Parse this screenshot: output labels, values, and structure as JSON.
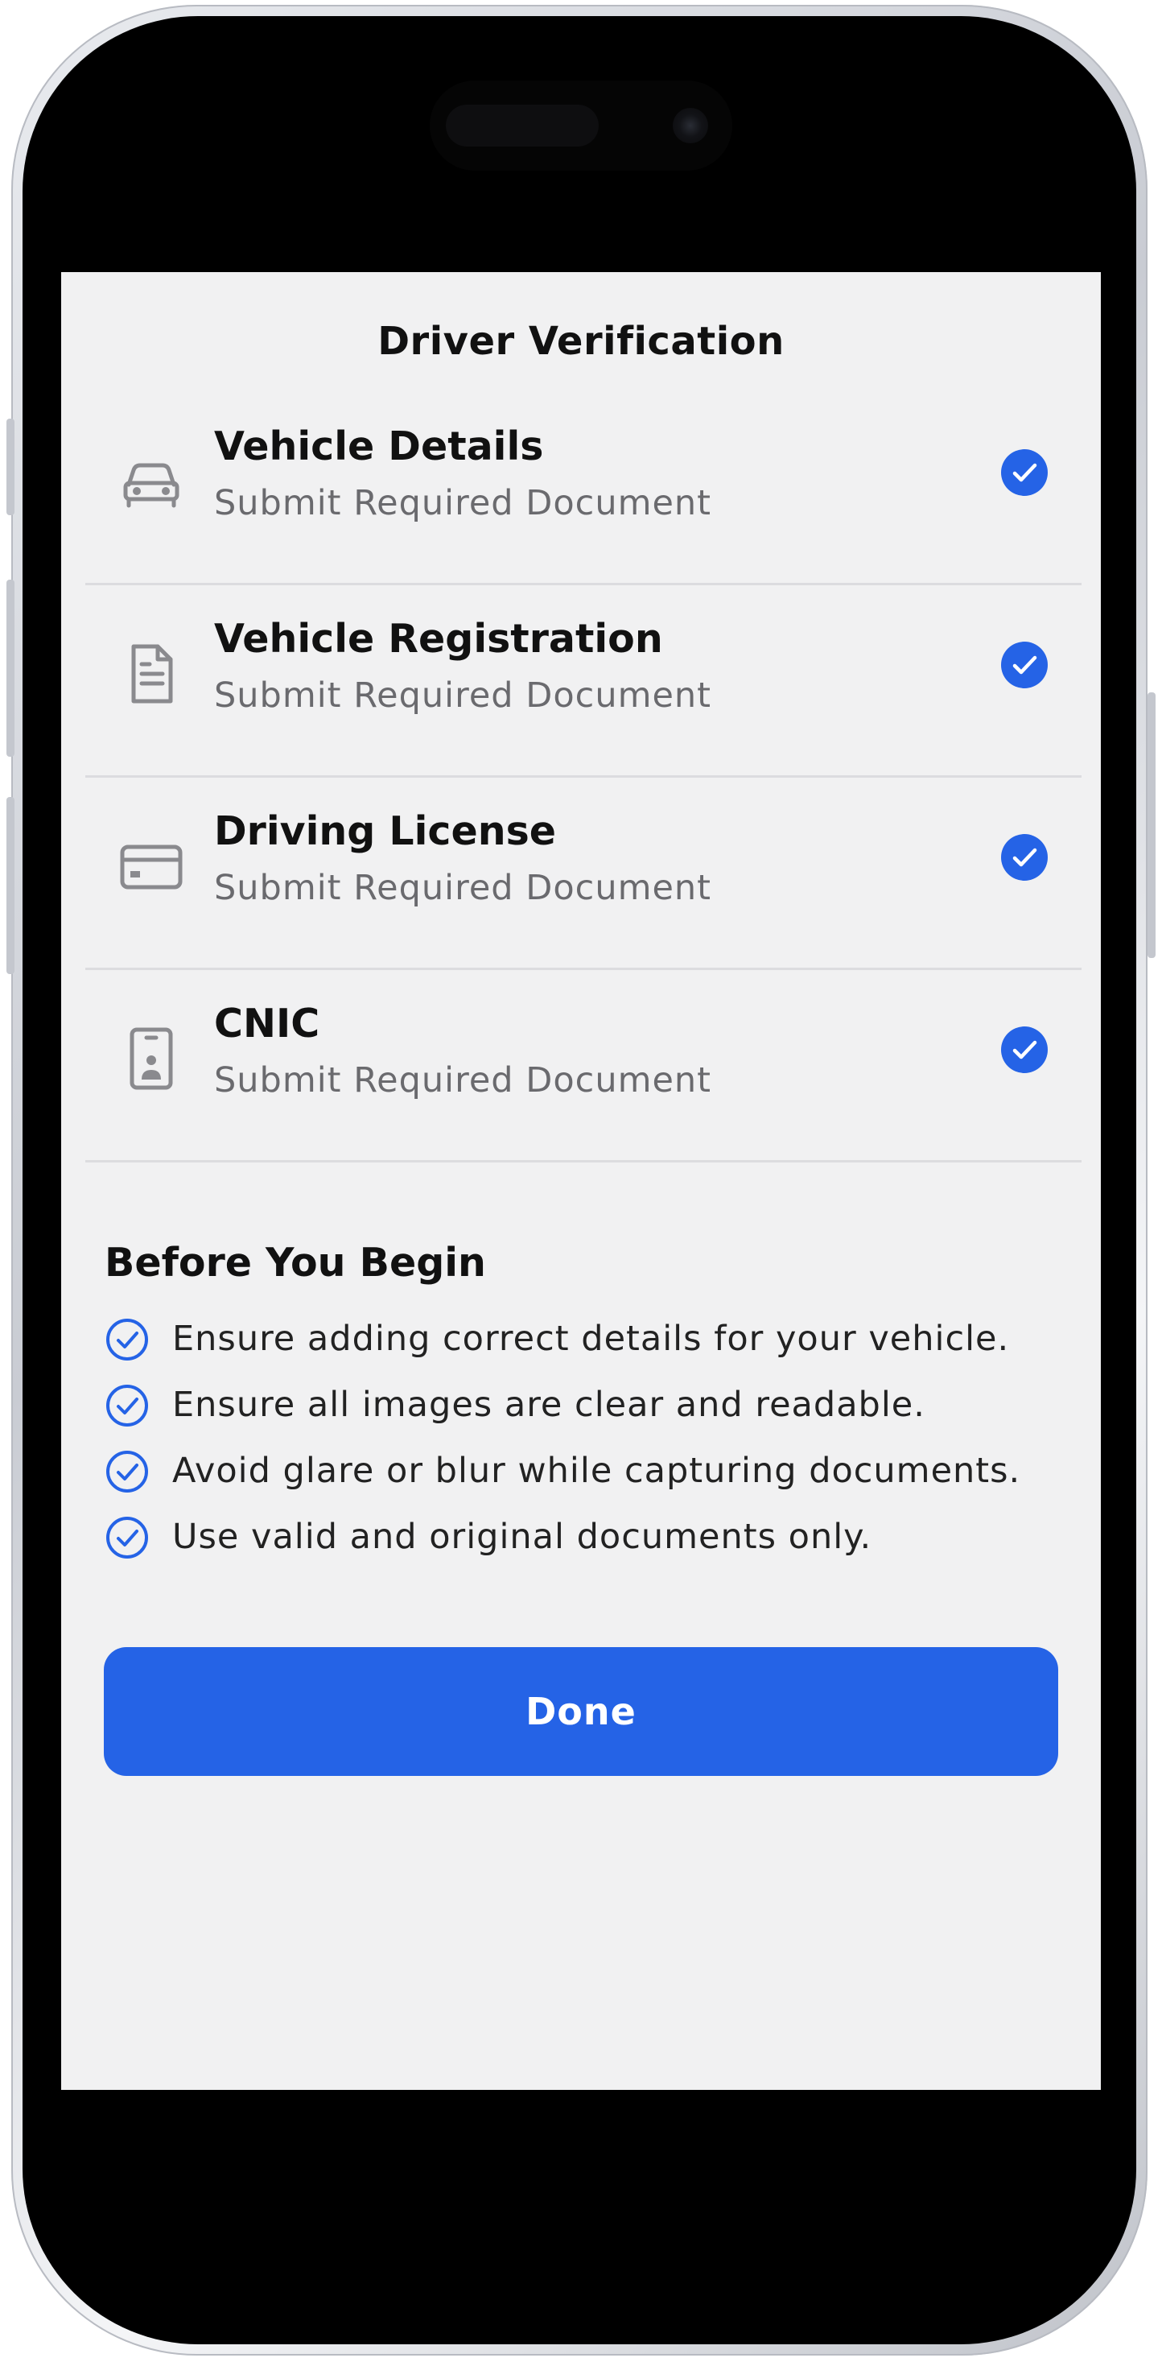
{
  "header": {
    "title": "Driver Verification"
  },
  "documents": [
    {
      "title": "Vehicle Details",
      "subtitle": "Submit Required Document",
      "icon": "car-icon",
      "status": "completed"
    },
    {
      "title": "Vehicle Registration",
      "subtitle": "Submit Required Document",
      "icon": "document-icon",
      "status": "completed"
    },
    {
      "title": "Driving License",
      "subtitle": "Submit Required Document",
      "icon": "card-icon",
      "status": "completed"
    },
    {
      "title": "CNIC",
      "subtitle": "Submit Required Document",
      "icon": "id-badge-icon",
      "status": "completed"
    }
  ],
  "tips": {
    "title": "Before You Begin",
    "items": [
      "Ensure adding correct details for your vehicle.",
      "Ensure all images are clear and readable.",
      "Avoid glare or blur while capturing documents.",
      "Use valid and original documents only."
    ]
  },
  "actions": {
    "done_label": "Done"
  },
  "colors": {
    "accent": "#2563e6",
    "background": "#f1f1f2",
    "icon_gray": "#8a8a8e",
    "divider": "#dcdcdf"
  }
}
